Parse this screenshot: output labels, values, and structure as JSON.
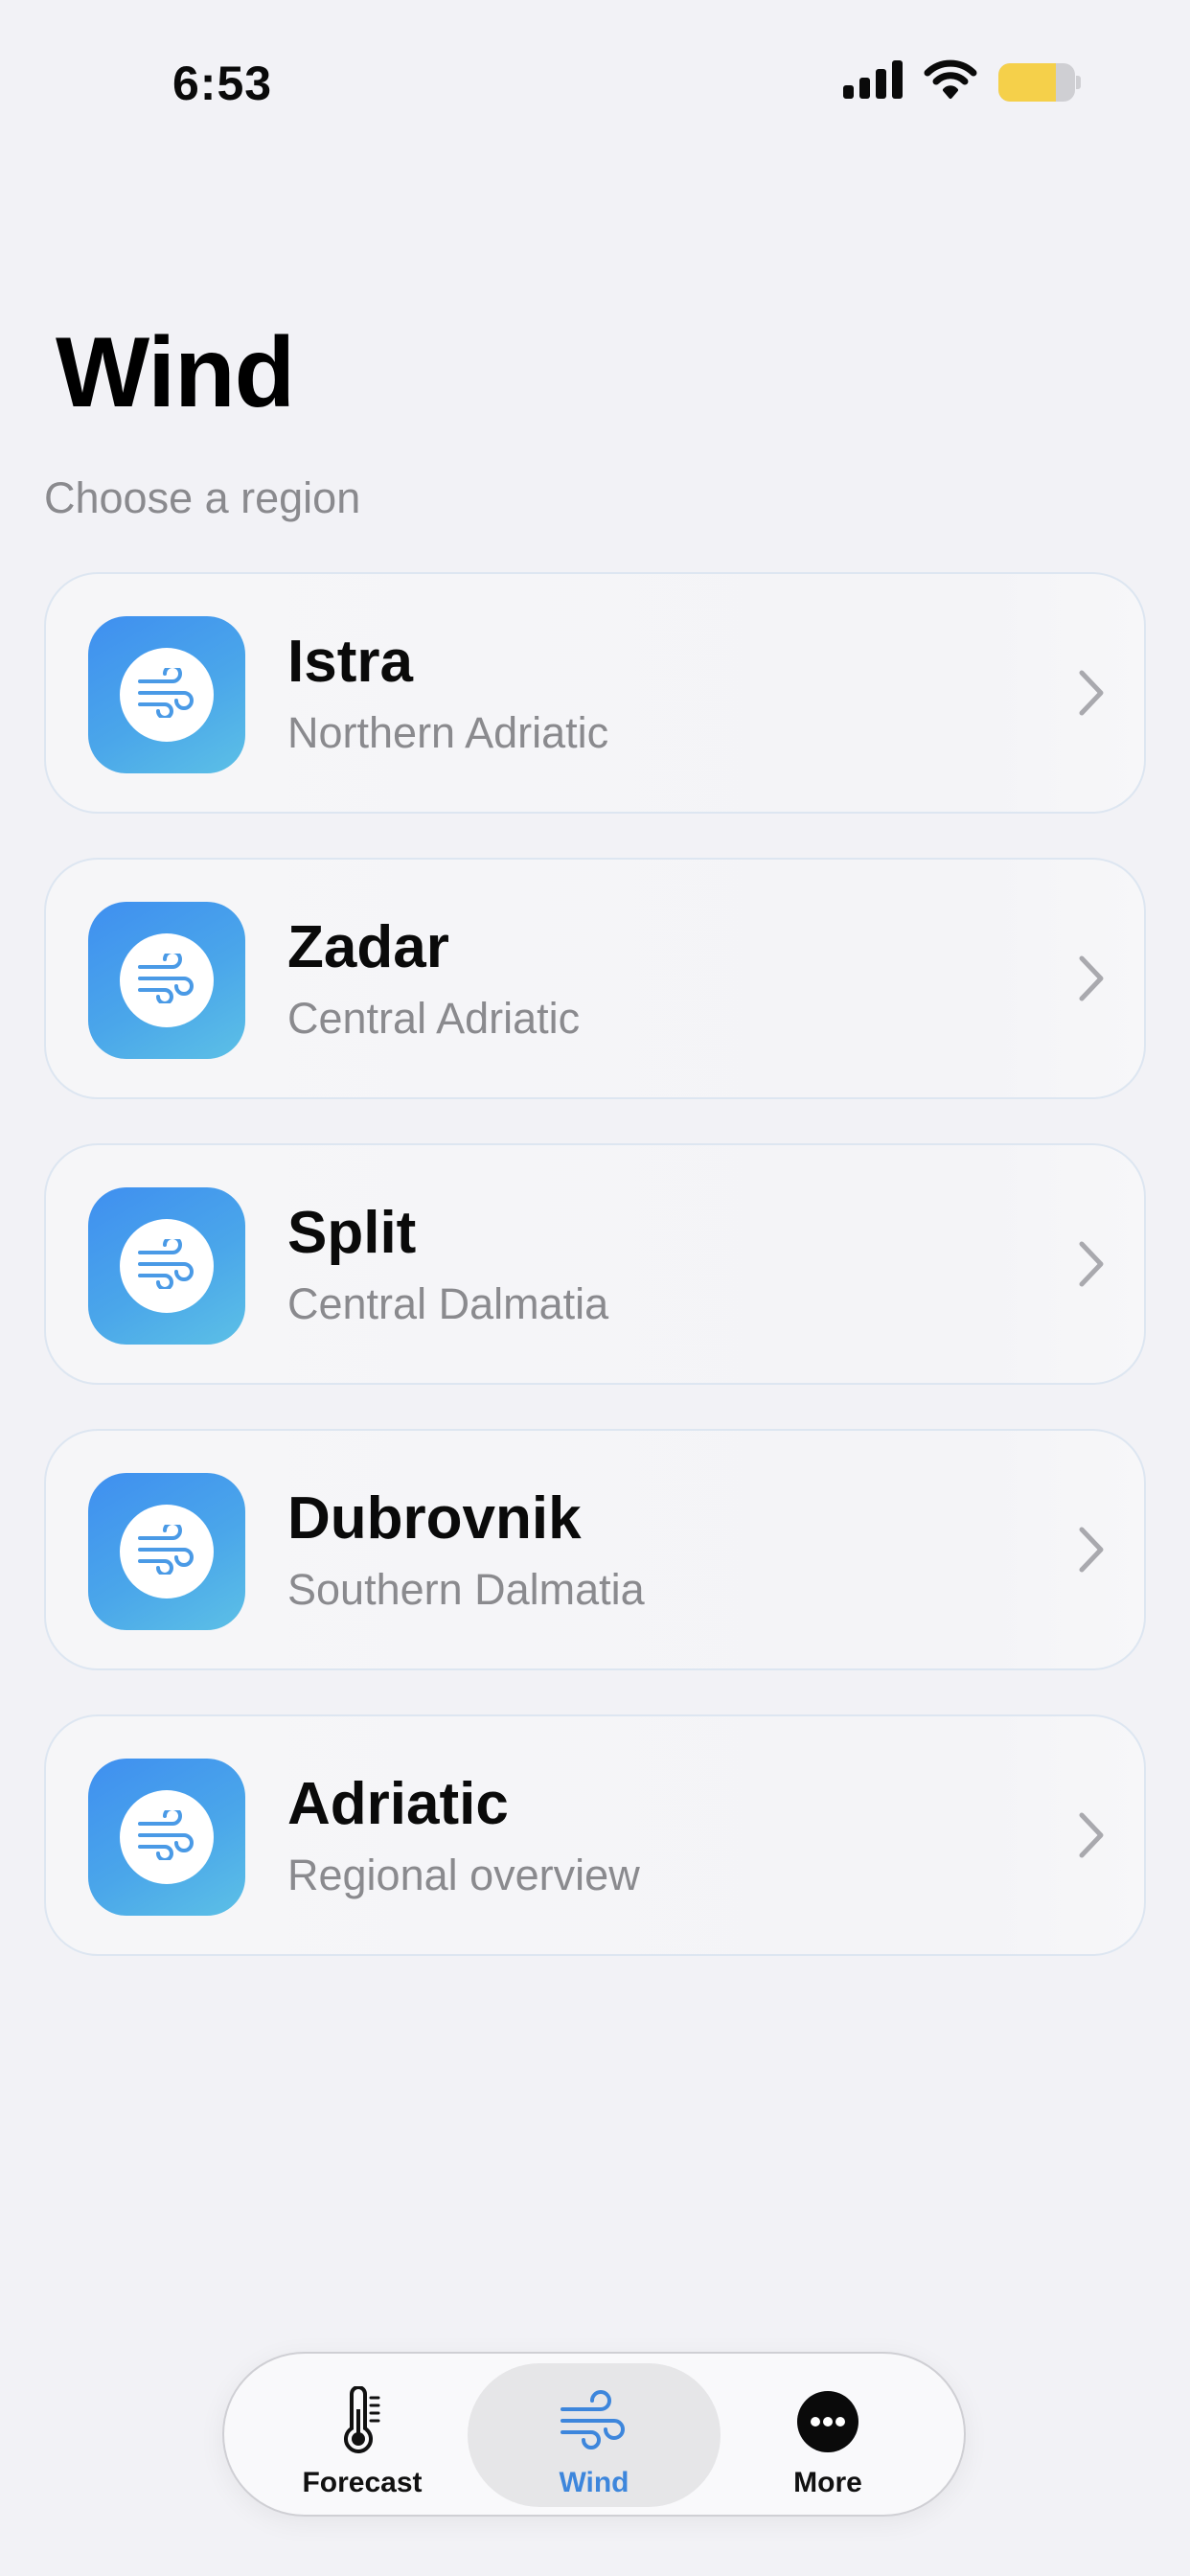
{
  "status_bar": {
    "time": "6:53",
    "battery_level": 0.75
  },
  "header": {
    "title": "Wind",
    "subtitle": "Choose a region"
  },
  "regions": [
    {
      "name": "Istra",
      "description": "Northern Adriatic",
      "icon": "wind-icon"
    },
    {
      "name": "Zadar",
      "description": "Central Adriatic",
      "icon": "wind-icon"
    },
    {
      "name": "Split",
      "description": "Central Dalmatia",
      "icon": "wind-icon"
    },
    {
      "name": "Dubrovnik",
      "description": "Southern Dalmatia",
      "icon": "wind-icon"
    },
    {
      "name": "Adriatic",
      "description": "Regional overview",
      "icon": "wind-icon"
    }
  ],
  "tab_bar": {
    "tabs": [
      {
        "label": "Forecast",
        "icon": "thermometer-icon",
        "active": false
      },
      {
        "label": "Wind",
        "icon": "wind-icon",
        "active": true
      },
      {
        "label": "More",
        "icon": "more-icon",
        "active": false
      }
    ]
  },
  "colors": {
    "background": "#f2f2f6",
    "accent": "#3d86dc",
    "icon_gradient_start": "#3f8ff0",
    "icon_gradient_end": "#5cc0e6",
    "battery": "#f5d04a",
    "secondary_text": "#8a8a8e"
  }
}
